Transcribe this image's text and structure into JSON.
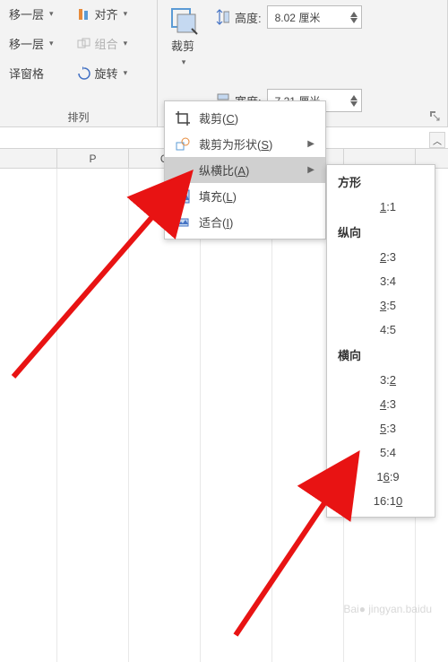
{
  "ribbon": {
    "arrange": {
      "bring_forward": "移一层",
      "send_backward": "移一层",
      "selection_pane": "译窗格",
      "align": "对齐",
      "group": "组合",
      "rotate": "旋转",
      "group_label": "排列"
    },
    "crop": {
      "label": "裁剪"
    },
    "size": {
      "height_label": "高度:",
      "width_label": "宽度:",
      "height_value": "8.02 厘米",
      "width_value": "7.21 厘米"
    }
  },
  "crop_menu": {
    "crop": "裁剪(C)",
    "crop_shape": "裁剪为形状(S)",
    "aspect": "纵横比(A)",
    "fill": "填充(L)",
    "fit": "适合(I)"
  },
  "aspect_menu": {
    "square_head": "方形",
    "square": [
      "1:1"
    ],
    "portrait_head": "纵向",
    "portrait": [
      "2:3",
      "3:4",
      "3:5",
      "4:5"
    ],
    "landscape_head": "横向",
    "landscape": [
      "3:2",
      "4:3",
      "5:3",
      "5:4",
      "16:9",
      "16:10"
    ]
  },
  "columns": [
    "P",
    "Q",
    "",
    "",
    "",
    ""
  ],
  "watermark": "Bai● jingyan.baidu"
}
